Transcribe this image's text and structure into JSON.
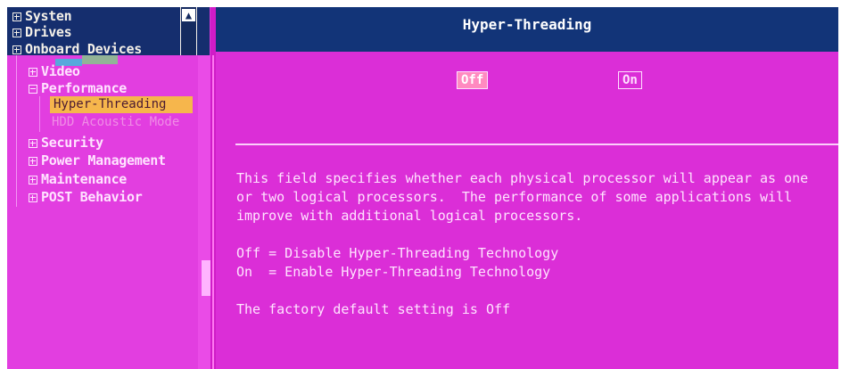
{
  "tree": {
    "top_items": [
      "Systen",
      "Drives",
      "Onboard Devices"
    ],
    "items": [
      {
        "label": "Video"
      },
      {
        "label": "Performance"
      },
      {
        "label": "Hyper-Threading"
      },
      {
        "label": "HDD Acoustic Mode"
      },
      {
        "label": "Security"
      },
      {
        "label": "Power Management"
      },
      {
        "label": "Maintenance"
      },
      {
        "label": "POST Behavior"
      }
    ],
    "scroll_up_icon": "▲"
  },
  "panel": {
    "title": "Hyper-Threading",
    "options": [
      "Off",
      "On"
    ],
    "selected_option": "Off",
    "help_lines": [
      "This field specifies whether each physical processor will appear as one",
      "or two logical processors.  The performance of some applications will",
      "improve with additional logical processors.",
      "Off = Disable Hyper-Threading Technology",
      "On  = Enable Hyper-Threading Technology",
      "The factory default setting is Off"
    ]
  },
  "colors": {
    "background": "#d63ad8",
    "title_bar": "#123478",
    "tree_header": "#152e6e",
    "selected_highlight": "#f6b64c"
  }
}
